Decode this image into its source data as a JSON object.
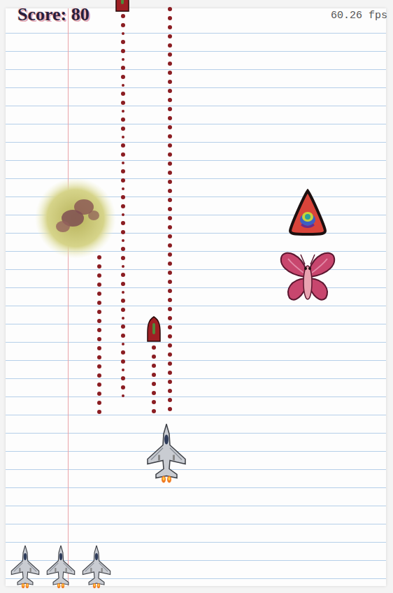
{
  "hud": {
    "score": "Score: 80",
    "fps": "60.26 fps"
  },
  "lives": 3,
  "player": {
    "kind": "jet"
  },
  "enemies": [
    {
      "kind": "explosion"
    },
    {
      "kind": "cone"
    },
    {
      "kind": "moth"
    }
  ],
  "projectiles": [
    {
      "kind": "trail"
    },
    {
      "kind": "trail"
    },
    {
      "kind": "trail"
    },
    {
      "kind": "trail"
    },
    {
      "kind": "missile"
    },
    {
      "kind": "missile"
    }
  ]
}
